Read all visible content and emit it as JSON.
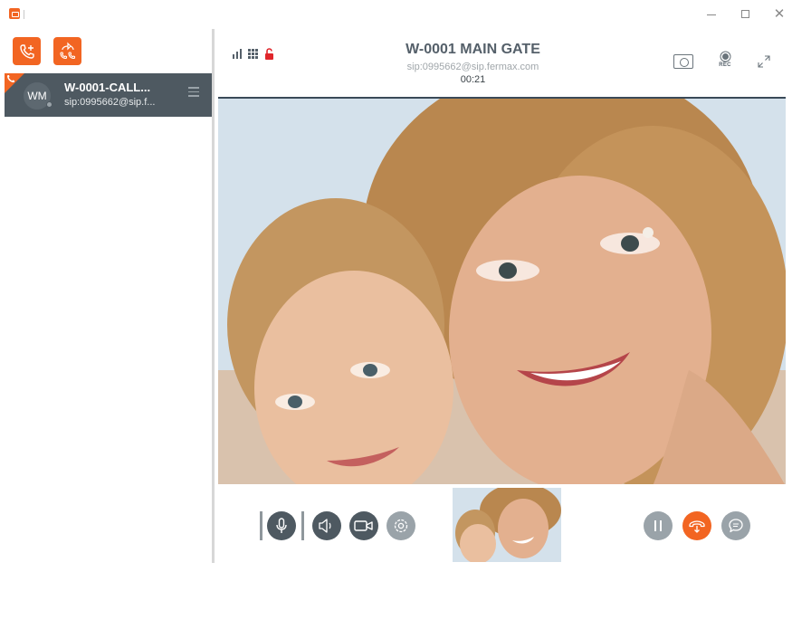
{
  "window": {
    "controls": {
      "minimize": "—",
      "maximize": "",
      "close": "✕"
    }
  },
  "sidebar": {
    "actions": [
      {
        "icon": "add-call-icon",
        "color": "#f26522"
      },
      {
        "icon": "transfer-call-icon",
        "color": "#f26522"
      }
    ],
    "calls": [
      {
        "avatar": "WM",
        "name": "W-0001-CALL...",
        "address": "sip:0995662@sip.f...",
        "active": true
      }
    ]
  },
  "call": {
    "title": "W-0001 MAIN GATE",
    "sip": "sip:0995662@sip.fermax.com",
    "timer": "00:21",
    "status_icons": [
      "signal-icon",
      "dialpad-icon",
      "unlock-icon"
    ],
    "top_actions": {
      "snapshot": "camera-snapshot-icon",
      "record_label": "REC",
      "fullscreen": "expand-icon"
    }
  },
  "controls": {
    "left": [
      "microphone-icon",
      "speaker-icon",
      "video-camera-icon",
      "settings-icon"
    ],
    "right": [
      "pause-icon",
      "hangup-icon",
      "chat-icon"
    ]
  },
  "colors": {
    "accent": "#f26522",
    "panel": "#4e5961",
    "muted": "#9aa3a9",
    "text": "#55606a"
  }
}
